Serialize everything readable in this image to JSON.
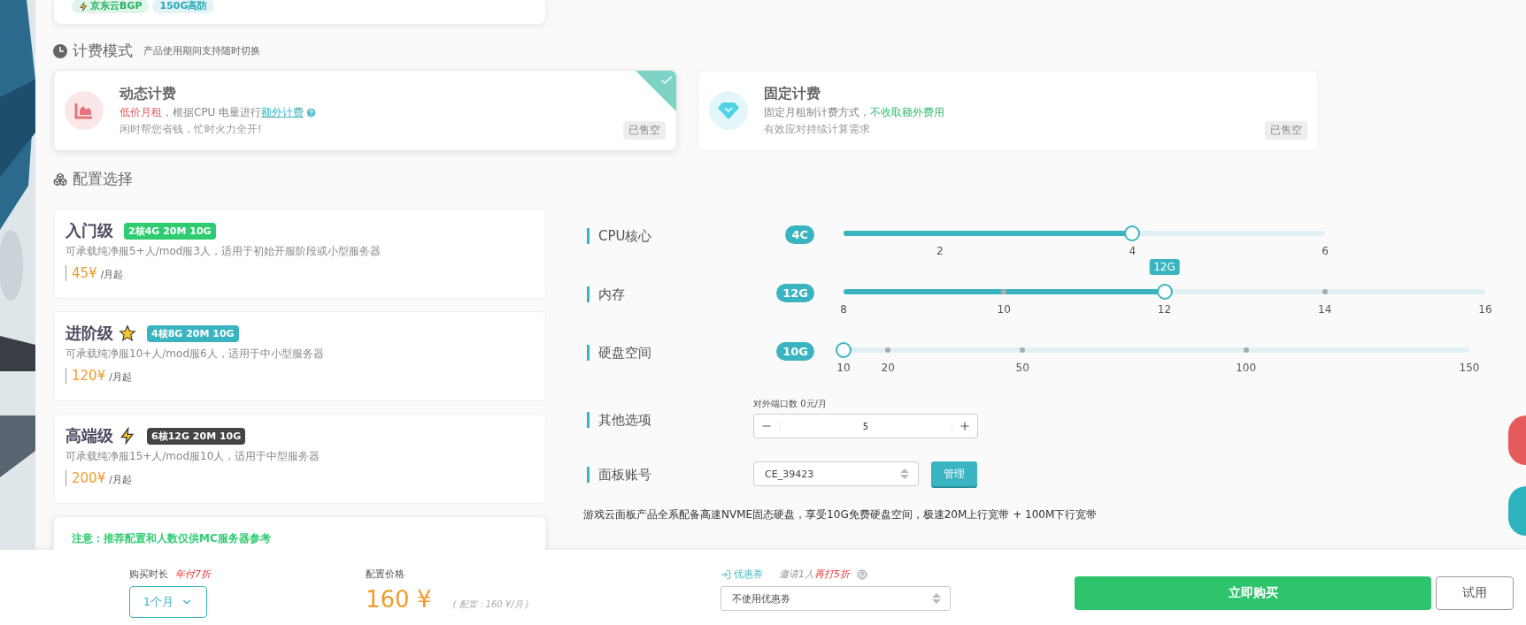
{
  "top_card": {
    "badges": [
      {
        "text": "京东云BGP",
        "color": "#22b35e",
        "kind": "bolt"
      },
      {
        "text": "150G高防",
        "color": "#2aa8b8",
        "kind": "plain"
      }
    ]
  },
  "billing": {
    "title": "计费模式",
    "subtitle": "产品使用期间支持随时切换",
    "options": [
      {
        "kind": "dynamic",
        "title": "动态计费",
        "selected": true,
        "help": true,
        "line1": [
          {
            "kind": "highlight",
            "text": "低价月租",
            "color": "#e0575b"
          },
          {
            "kind": "text",
            "text": "，根据CPU 电量进行"
          },
          {
            "kind": "link",
            "text": "额外计费"
          }
        ],
        "line2": "闲时帮您省钱，忙时火力全开!",
        "status": "已售空"
      },
      {
        "kind": "fixed",
        "title": "固定计费",
        "selected": false,
        "help": false,
        "line1": [
          {
            "kind": "text",
            "text": "固定月租制计费方式，"
          },
          {
            "kind": "highlight",
            "text": "不收取额外费用",
            "color": "#2fbf71"
          }
        ],
        "line2": "有效应对持续计算需求",
        "status": "已售空"
      }
    ]
  },
  "config": {
    "title": "配置选择",
    "tiers": [
      {
        "kind": "basic",
        "name": "入门级",
        "spec": "2核4G 20M 10G",
        "color": "#2ecc71",
        "description": "可承载纯净服5+人/mod服3人，适用于初始开服阶段或小型服务器",
        "price": "45¥",
        "unit": "/月起"
      },
      {
        "kind": "star",
        "name": "进阶级",
        "spec": "4核8G 20M 10G",
        "color": "#3bb4c1",
        "description": "可承载纯净服10+人/mod服6人，适用于中小型服务器",
        "price": "120¥",
        "unit": "/月起"
      },
      {
        "kind": "bolt",
        "name": "高端级",
        "spec": "6核12G 20M 10G",
        "color": "#444444",
        "description": "可承载纯净服15+人/mod服10人，适用于中型服务器",
        "price": "200¥",
        "unit": "/月起"
      }
    ],
    "note": "注意：推荐配置和人数仅供MC服务器参考",
    "options": [
      {
        "kind": "slider",
        "label": "CPU核心",
        "value": "4C",
        "level": 0.6,
        "ticks": [
          "2",
          "4",
          "6"
        ]
      },
      {
        "kind": "slider",
        "label": "内存",
        "value": "12G",
        "tooltip": "12G",
        "level": 0.5,
        "ticks": [
          "8",
          "10",
          "12",
          "14",
          "16"
        ]
      },
      {
        "kind": "slider",
        "label": "硬盘空间",
        "value": "10G",
        "level": 0,
        "ticks": [
          "10",
          "20",
          "50",
          "100",
          "150"
        ]
      },
      {
        "kind": "stepper",
        "label": "其他选项",
        "caption": "对外端口数 0元/月",
        "value": "5"
      },
      {
        "kind": "select",
        "label": "面板账号",
        "value": "CE_39423",
        "button": "管理"
      }
    ],
    "footnote": "游戏云面板产品全系配备高速NVME固态硬盘，享受10G免费硬盘空间，极速20M上行宽带 + 100M下行宽带"
  },
  "bottom": {
    "duration": {
      "label": "购买时长",
      "promo": "年付7折",
      "value": "1个月"
    },
    "price": {
      "label": "配置价格",
      "amount": "160 ¥",
      "detail": "( 配置：160 ¥/月 )"
    },
    "coupon": {
      "label": "优惠券",
      "hint": "邀请1人",
      "promo": "再打5折",
      "value": "不使用优惠券"
    },
    "buttons": [
      {
        "kind": "primary",
        "text": "立即购买"
      },
      {
        "kind": "secondary",
        "text": "试用"
      }
    ]
  }
}
